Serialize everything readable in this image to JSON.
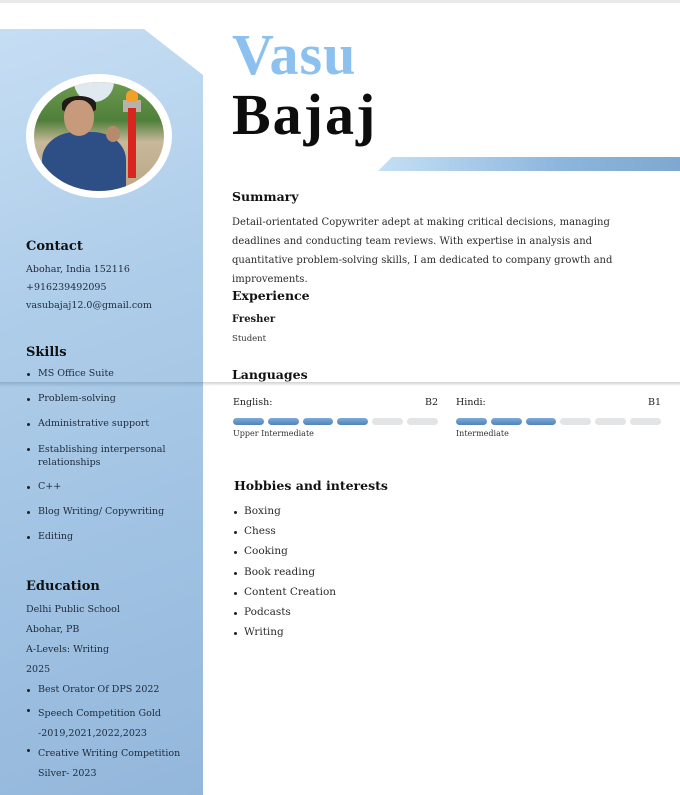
{
  "name": {
    "first": "Vasu",
    "last": "Bajaj"
  },
  "colors": {
    "accent_light": "#8cc1ef",
    "sidebar": "#aecde9",
    "bar_on": "#5a8cc2",
    "bar_off": "#e2e4e6"
  },
  "sidebar": {
    "contact": {
      "title": "Contact",
      "lines": [
        "Abohar, India 152116",
        "+916239492095",
        "vasubajaj12.0@gmail.com"
      ]
    },
    "skills": {
      "title": "Skills",
      "items": [
        "MS Office Suite",
        "Problem-solving",
        "Administrative support",
        "Establishing interpersonal relationships",
        "C++",
        "Blog Writing/ Copywriting",
        "Editing"
      ]
    },
    "education": {
      "title": "Education",
      "lines": [
        "Delhi Public School",
        "Abohar, PB",
        "A-Levels: Writing",
        "2025"
      ],
      "achievements": [
        "Best Orator Of DPS 2022",
        "Speech Competition Gold -2019,2021,2022,2023",
        "Creative Writing Competition Silver- 2023"
      ]
    }
  },
  "main": {
    "summary": {
      "title": "Summary",
      "text": "Detail-orientated Copywriter adept at making critical decisions, managing deadlines and conducting team reviews. With expertise in analysis and quantitative problem-solving skills, I am dedicated to company growth and improvements."
    },
    "experience": {
      "title": "Experience",
      "role": "Fresher",
      "subtitle": "Student"
    },
    "languages": {
      "title": "Languages",
      "items": [
        {
          "name": "English:",
          "grade": "B2",
          "level": "Upper Intermediate",
          "filled": 4,
          "total": 6
        },
        {
          "name": "Hindi:",
          "grade": "B1",
          "level": "Intermediate",
          "filled": 3,
          "total": 6
        }
      ]
    },
    "hobbies": {
      "title": "Hobbies and interests",
      "items": [
        "Boxing",
        "Chess",
        "Cooking",
        "Book reading",
        "Content Creation",
        "Podcasts",
        "Writing"
      ]
    }
  }
}
